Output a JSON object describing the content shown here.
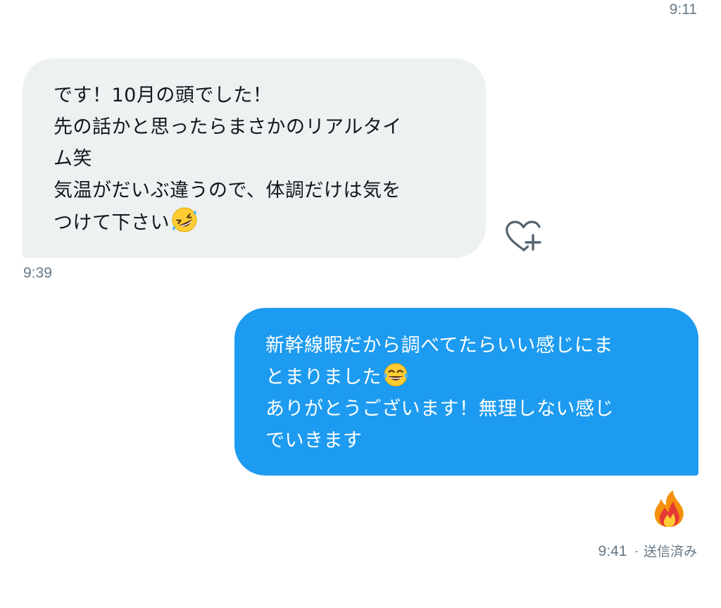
{
  "thread": {
    "top_timestamp": "9:11",
    "received_message": {
      "lines": [
        "です！10月の頭でした！",
        "先の話かと思ったらまさかのリアルタイ",
        "ム笑",
        "気温がだいぶ違うので、体調だけは気を",
        "つけて下さい"
      ],
      "trailing_emoji": "rolling-on-floor-laughing-emoji",
      "timestamp": "9:39",
      "bubble_color": "#edf1f2",
      "text_color": "#14171a"
    },
    "add_reaction_icon": "heart-plus-icon",
    "sent_message": {
      "lines": [
        "新幹線暇だから調べてたらいい感じにま",
        "とまりました",
        "ありがとうございます！無理しない感じ",
        "でいきます"
      ],
      "inline_emoji": "tears-of-joy-emoji",
      "reaction_emoji": "fire-emoji",
      "timestamp": "9:41",
      "separator": "·",
      "status": "送信済み",
      "bubble_color": "#1d9bf0",
      "text_color": "#ffffff"
    },
    "meta_color": "#657786"
  }
}
